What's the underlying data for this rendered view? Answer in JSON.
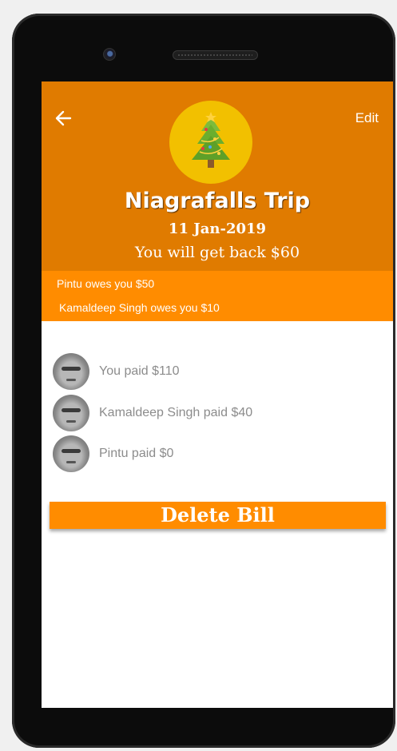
{
  "header": {
    "edit_label": "Edit",
    "title": "Niagrafalls Trip",
    "date": "11 Jan-2019",
    "balance_text": "You will get back $60",
    "avatar_icon": "christmas-tree-icon",
    "back_icon": "arrow-left-icon"
  },
  "owes": [
    "Pintu owes you $50",
    "Kamaldeep Singh owes you $10"
  ],
  "payments": [
    {
      "text": "You paid $110"
    },
    {
      "text": "Kamaldeep Singh paid $40"
    },
    {
      "text": "Pintu paid $0"
    }
  ],
  "actions": {
    "delete_label": "Delete Bill"
  },
  "colors": {
    "header_bg": "#e07b00",
    "owes_bg": "#ff8c00",
    "avatar_bg": "#f2c000",
    "button_bg": "#ff8c00"
  }
}
